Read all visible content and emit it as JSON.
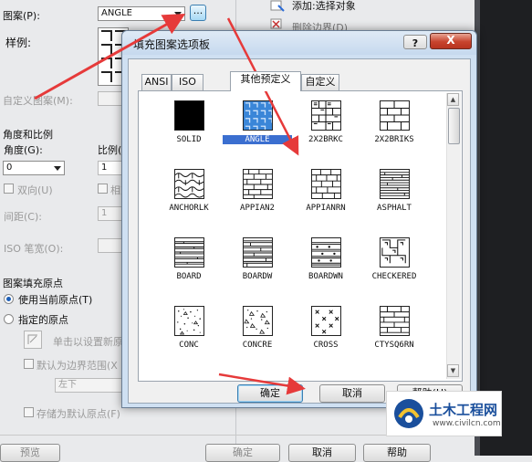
{
  "background_dialog": {
    "pattern_label": "图案(P):",
    "pattern_value": "ANGLE",
    "browse_button": "...",
    "sample_label": "样例:",
    "custom_label": "自定义图案(M):",
    "angle_scale_section": "角度和比例",
    "angle_label": "角度(G):",
    "angle_value": "0",
    "scale_label": "比例(",
    "scale_value": "1",
    "double_label": "双向(U)",
    "relative_label": "相对",
    "spacing_label": "间距(C):",
    "spacing_value": "1",
    "iso_pen_label": "ISO 笔宽(O):",
    "origin_section": "图案填充原点",
    "use_current_origin": "使用当前原点(T)",
    "specified_origin": "指定的原点",
    "click_set_origin": "单击以设置新原",
    "default_boundary": "默认为边界范围(X",
    "position_value": "左下",
    "store_default": "存储为默认原点(F)",
    "add_pick": "添加:选择对象",
    "remove_boundary": "删除边界(D)",
    "preview_button": "预览",
    "ok_button": "确定",
    "cancel_button": "取消",
    "help_button": "帮助"
  },
  "dialog": {
    "title": "填充图案选项板",
    "help_glyph": "?",
    "close_glyph": "X",
    "tabs": [
      "ANSI",
      "ISO",
      "其他预定义",
      "自定义"
    ],
    "active_tab": "其他预定义",
    "patterns": [
      "SOLID",
      "ANGLE",
      "2X2BRKC",
      "2X2BRIKS",
      "ANCHORLK",
      "APPIAN2",
      "APPIANRN",
      "ASPHALT",
      "BOARD",
      "BOARDW",
      "BOARDWN",
      "CHECKERED",
      "CONC",
      "CONCRE",
      "CROSS",
      "CTYSQ6RN"
    ],
    "selected_pattern": "ANGLE",
    "ok_button": "确定",
    "cancel_button": "取消",
    "help_button": "帮助(H)"
  },
  "watermark": {
    "title": "土木工程网",
    "url": "www.civilcn.com"
  },
  "colors": {
    "annotation_arrow": "#e63a3a",
    "selection": "#3b6fd0"
  }
}
